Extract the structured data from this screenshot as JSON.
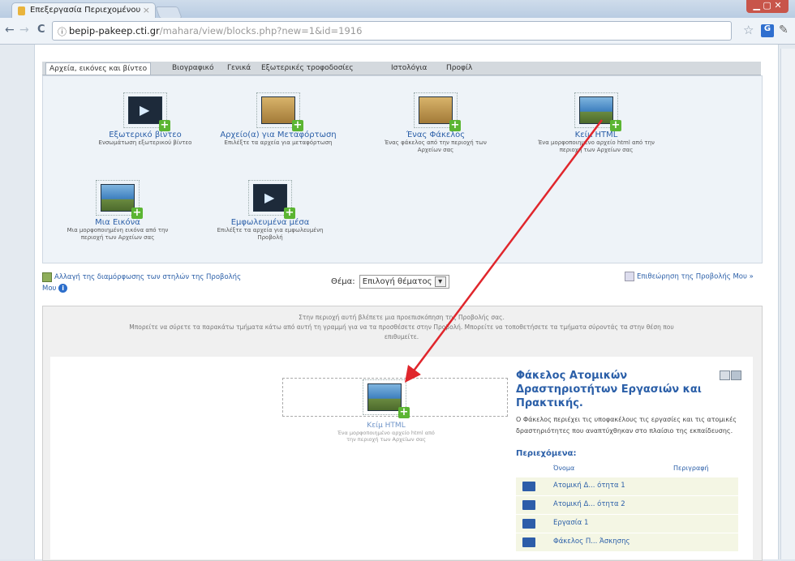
{
  "browser": {
    "tab_title": "Επεξεργασία Περιεχομένου",
    "tab_close": "×",
    "window_controls": "▁ ▢ ✕",
    "url_host": "bepip-pakeep.cti.gr",
    "url_path": "/mahara/view/blocks.php?new=1&id=1916",
    "back_glyph": "←",
    "forward_glyph": "→",
    "reload_glyph": "C",
    "star_glyph": "☆",
    "ext_glyph": "G",
    "wrench_glyph": "✎"
  },
  "tabs": [
    {
      "label": "Αρχεία, εικόνες και βίντεο",
      "active": true
    },
    {
      "label": "Βιογραφικό",
      "active": false
    },
    {
      "label": "Γενικά",
      "active": false
    },
    {
      "label": "Εξωτερικές τροφοδοσίες",
      "active": false
    },
    {
      "label": "Ιστολόγια",
      "active": false
    },
    {
      "label": "Προφίλ",
      "active": false
    }
  ],
  "blocks": [
    {
      "name": "Εξωτερικό βίντεο",
      "desc": "Ενσωμάτωση εξωτερικού βίντεο",
      "icon": "video"
    },
    {
      "name": "Αρχείο(α) για Μεταφόρτωση",
      "desc": "Επιλέξτε τα αρχεία για μεταφόρτωση",
      "icon": "folder"
    },
    {
      "name": "Ένας Φάκελος",
      "desc": "Ένας φάκελος από την περιοχή των Αρχείων σας",
      "icon": "folder"
    },
    {
      "name": "Κείμ HTML",
      "desc": "Ένα μορφοποιημένο αρχείο html από την περιοχή των Αρχείων σας",
      "icon": "photo"
    },
    {
      "name": "Μια Εικόνα",
      "desc": "Μια μορφοποιημένη εικόνα από την περιοχή των Αρχείων σας",
      "icon": "photo"
    },
    {
      "name": "Εμφωλευμένα μέσα",
      "desc": "Επιλέξτε τα αρχεία για εμφωλευμένη Προβολή",
      "icon": "video"
    }
  ],
  "controls": {
    "change_columns": "Αλλαγή της διαμόρφωσης των στηλών της Προβολής",
    "more": "Μου",
    "info_glyph": "i",
    "theme_label": "Θέμα:",
    "theme_value": "Επιλογή θέματος",
    "theme_arrow": "▾",
    "preview": "Επιθεώρηση της Προβολής Μου »"
  },
  "notice": {
    "line1": "Στην περιοχή αυτή βλέπετε μια προεπισκόπηση της Προβολής σας.",
    "line2": "Μπορείτε να σύρετε τα παρακάτω τμήματα κάτω από αυτή τη γραμμή για να τα προσθέσετε στην Προβολή. Μπορείτε να τοποθετήσετε τα τμήματα σύροντάς τα στην θέση που",
    "line3": "επιθυμείτε."
  },
  "dragged": {
    "name": "Κείμ HTML",
    "desc": "Ένα μορφοποιημένο αρχείο html από την περιοχή των Αρχείων σας"
  },
  "folder_panel": {
    "title": "Φάκελος Ατομικών Δραστηριοτήτων Εργασιών και Πρακτικής.",
    "desc": "Ο Φάκελος περιέχει τις υποφακέλους τις εργασίες και τις ατομικές δραστηριότητες που αναπτύχθηκαν στο πλαίσιο της εκπαίδευσης.",
    "contents_label": "Περιεχόμενα:",
    "col_name": "Όνομα",
    "col_desc": "Περιγραφή",
    "items": [
      "Ατομική Δ... ότητα 1",
      "Ατομική Δ... ότητα 2",
      "Εργασία 1",
      "Φάκελος Π... Άσκησης"
    ]
  },
  "colors": {
    "accent": "#2b5fa8",
    "arrow": "#e0262c",
    "plus": "#5bb532"
  }
}
